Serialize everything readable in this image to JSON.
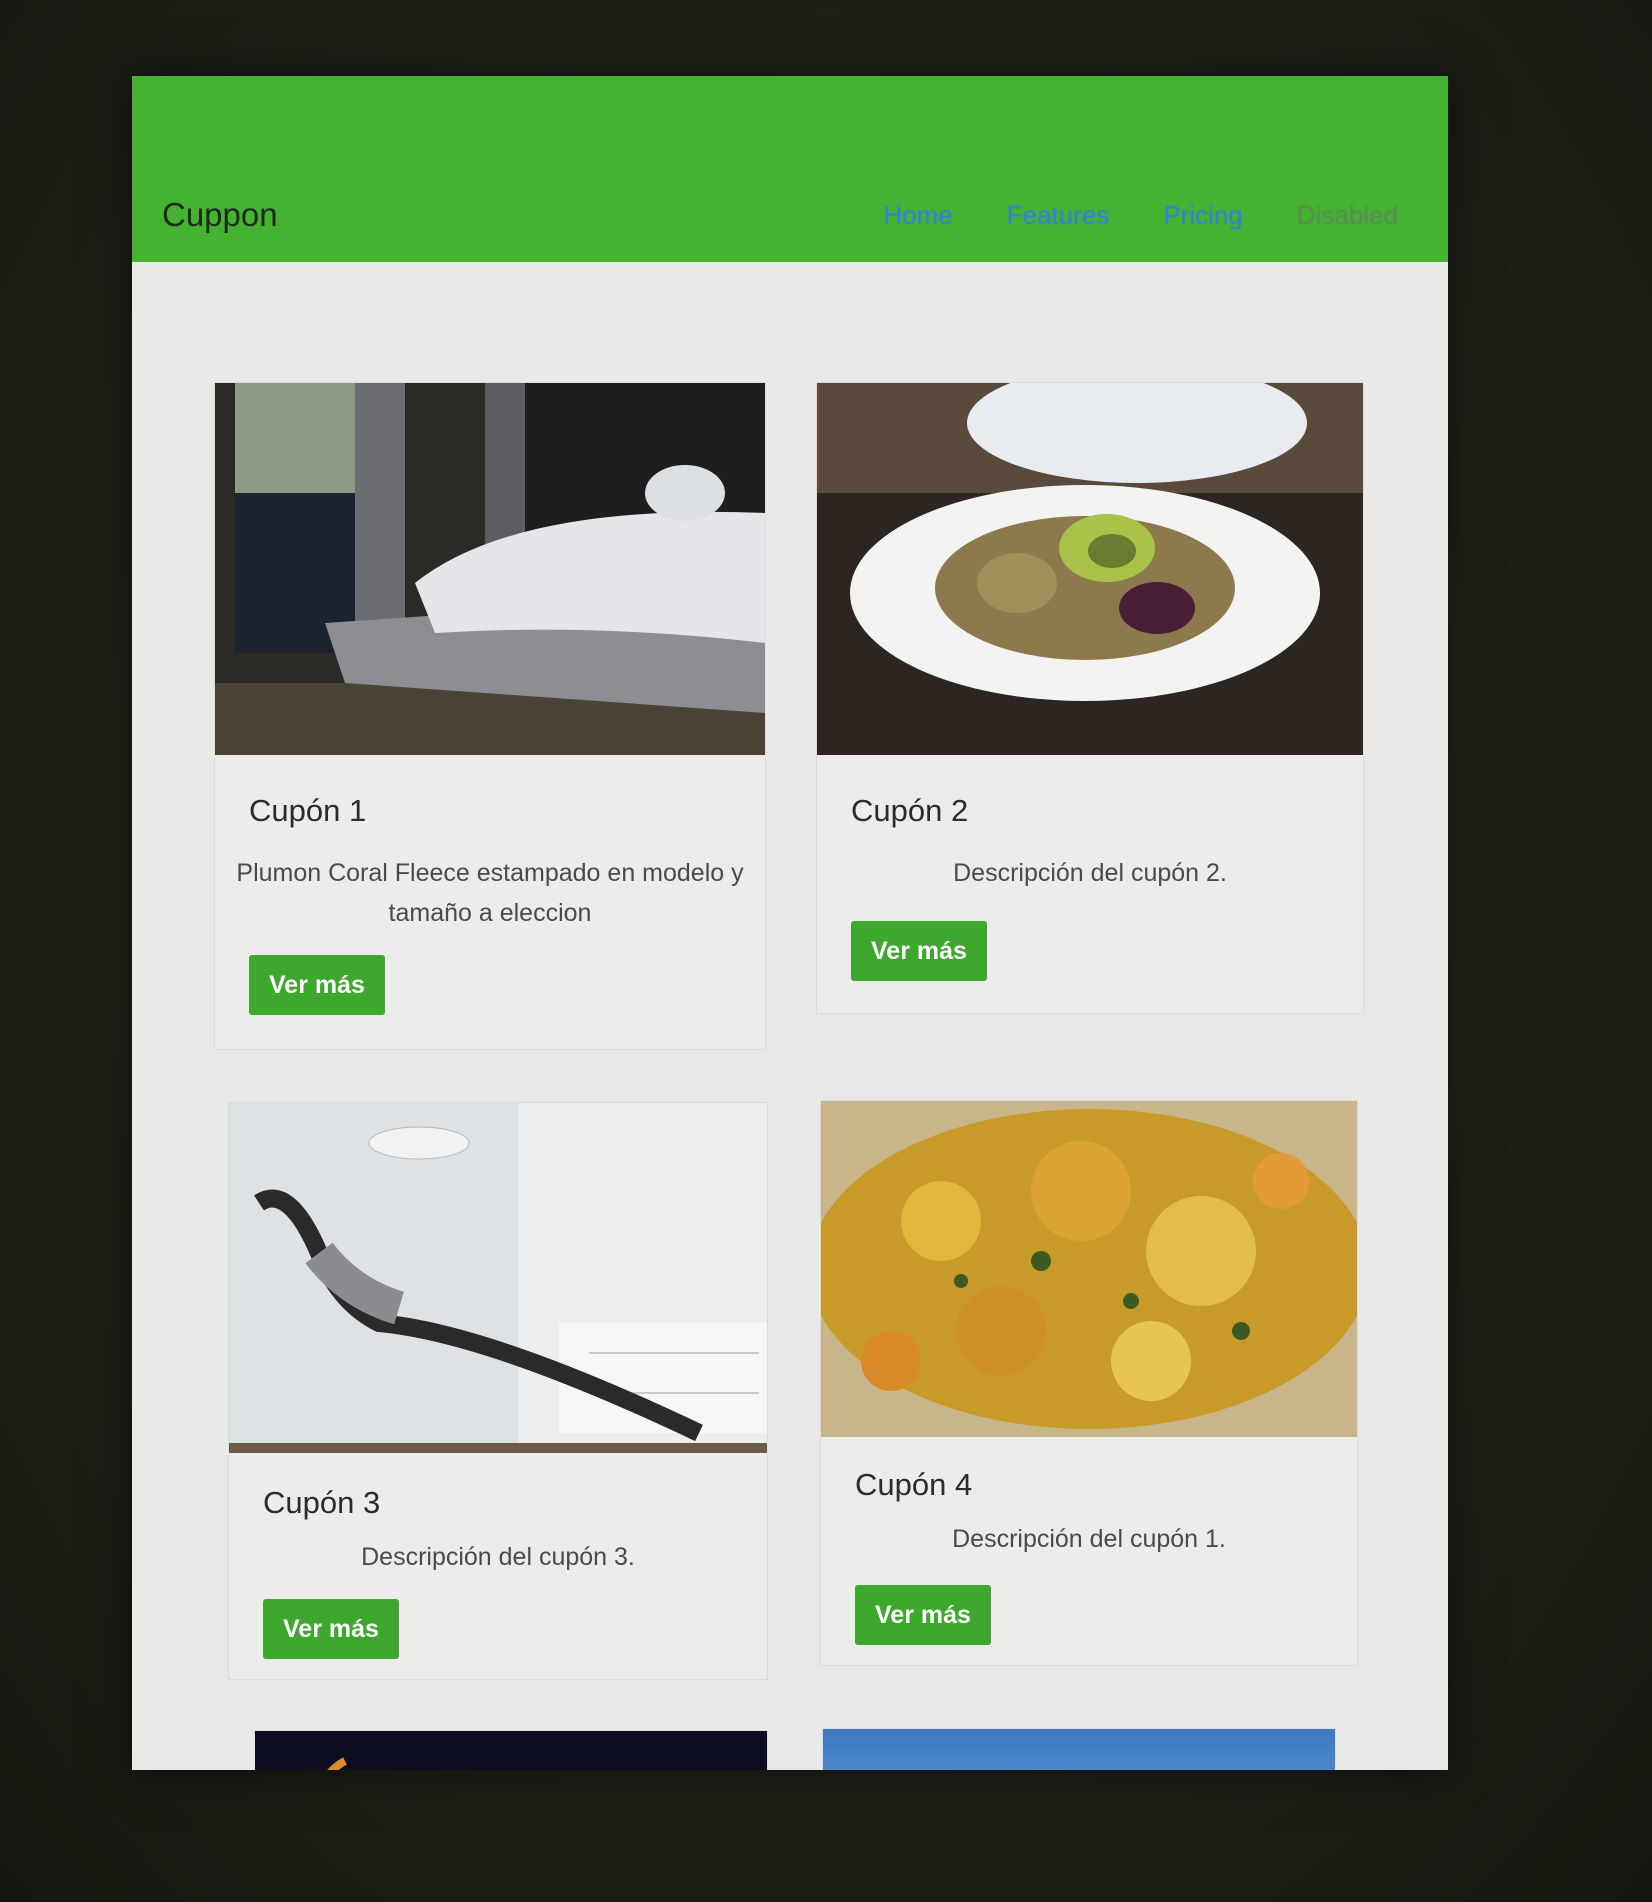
{
  "navbar": {
    "brand": "Cuppon",
    "links": [
      {
        "label": "Home"
      },
      {
        "label": "Features"
      },
      {
        "label": "Pricing"
      },
      {
        "label": "Disabled"
      }
    ]
  },
  "cards": [
    {
      "title": "Cupón 1",
      "text": "Plumon Coral Fleece estampado en modelo y tamaño a eleccion",
      "button": "Ver más"
    },
    {
      "title": "Cupón 2",
      "text": "Descripción del cupón 2.",
      "button": "Ver más"
    },
    {
      "title": "Cupón 3",
      "text": "Descripción del cupón 3.",
      "button": "Ver más"
    },
    {
      "title": "Cupón 4",
      "text": "Descripción del cupón 1.",
      "button": "Ver más"
    }
  ],
  "colors": {
    "navbar": "#45b232",
    "button": "#3ea72d",
    "link": "#2f7cf0"
  }
}
